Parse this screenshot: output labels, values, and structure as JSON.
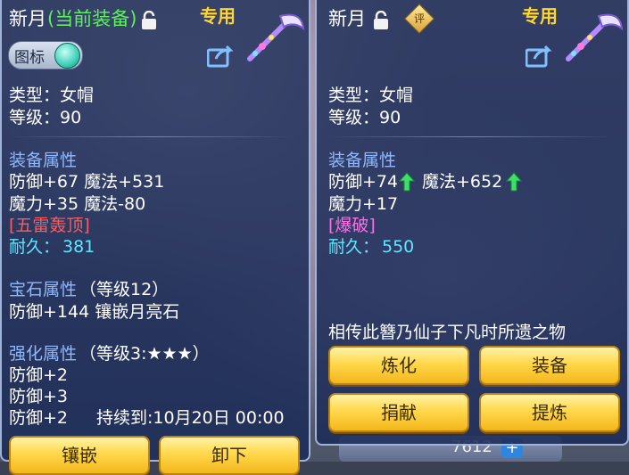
{
  "left": {
    "name": "新月",
    "equipped_tag": "(当前装备)",
    "exclusive_label": "专用",
    "icon_toggle_label": "图标",
    "type_line": "类型：女帽",
    "level_line": "等级：90",
    "section_equip_attr": "装备属性",
    "attr_line1": "防御+67 魔法+531",
    "attr_line2": "魔力+35 魔法-80",
    "special_effect": "[五雷轰顶]",
    "durability_label": "耐久：",
    "durability_value": "381",
    "gem_section_title": "宝石属性",
    "gem_level": "（等级12）",
    "gem_line": "防御+144 镶嵌月亮石",
    "enhance_section_title": "强化属性",
    "enhance_level": "（等级3:★★★）",
    "enhance_line1": "防御+2",
    "enhance_line2": "防御+3",
    "enhance_line3": "防御+2",
    "duration_label": "持续到:10月20日 00:00",
    "button_inlay": "镶嵌",
    "button_remove": "卸下"
  },
  "right": {
    "name": "新月",
    "rating_badge": "评",
    "exclusive_label": "专用",
    "type_line": "类型：女帽",
    "level_line": "等级：90",
    "section_equip_attr": "装备属性",
    "attr_def": "防御+74",
    "attr_magic": "魔法+652",
    "attr_line2": "魔力+17",
    "special_effect": "[爆破]",
    "durability_label": "耐久：",
    "durability_value": "550",
    "description": "相传此簪乃仙子下凡时所遗之物",
    "button_refine": "炼化",
    "button_equip": "装备",
    "button_donate": "捐献",
    "button_extract": "提炼"
  },
  "background": {
    "currency_value": "7612",
    "plus_label": "+"
  },
  "colors": {
    "gold_title": "#ffd531",
    "section_blue": "#8fb8ff",
    "effect_red": "#ff5b5b",
    "effect_pink": "#ff6ee8",
    "value_cyan": "#5fe7ff",
    "tag_green": "#5ef05e",
    "button_gold": "#ffd84a"
  },
  "icons": [
    "lock-icon",
    "share-icon",
    "weapon-icon",
    "green-up-arrow-icon",
    "rating-badge-icon",
    "icon-toggle-ball"
  ]
}
